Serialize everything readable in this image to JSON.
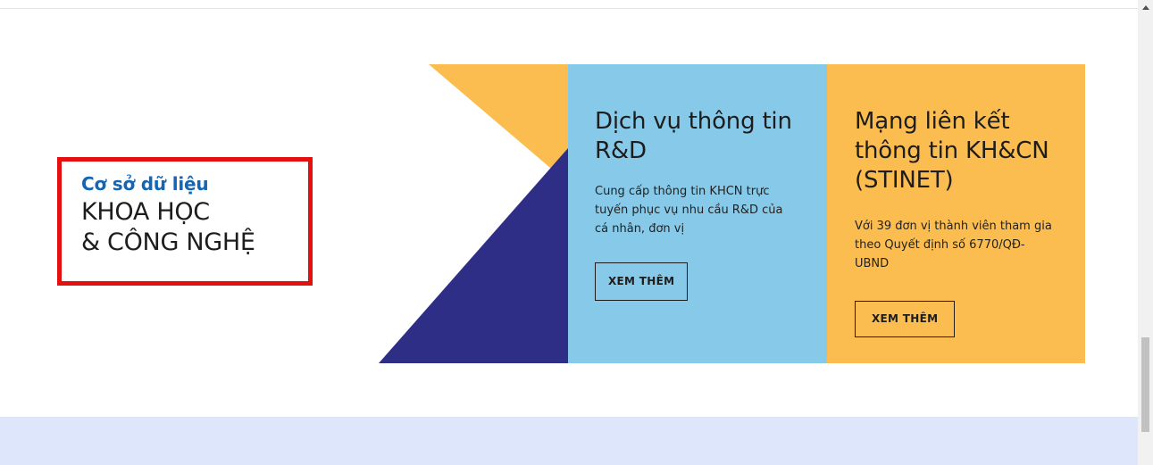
{
  "left_box": {
    "subtitle": "Cơ sở dữ liệu",
    "title_line1": "KHOA HỌC",
    "title_line2": "& CÔNG NGHỆ"
  },
  "cards": [
    {
      "title_line1": "Dịch vụ thông tin",
      "title_line2": "R&D",
      "desc_line1": "Cung cấp thông tin KHCN trực",
      "desc_line2": "tuyến phục vụ nhu cầu R&D của",
      "desc_line3": "cá nhân, đơn vị",
      "button": "XEM THÊM"
    },
    {
      "title_line1": "Mạng liên kết",
      "title_line2": "thông tin KH&CN",
      "title_line3": "(STINET)",
      "desc_line1": "Với 39 đơn vị thành viên tham gia",
      "desc_line2": "theo Quyết định số 6770/QĐ-",
      "desc_line3": "UBND",
      "button": "XEM THÊM"
    }
  ],
  "colors": {
    "box_border": "#e40f0f",
    "subtitle": "#1565b5",
    "blue_card": "#87c9e9",
    "yellow_card": "#fcbd50",
    "navy_triangle": "#2e2e86",
    "bottom_band": "#dde6fb"
  },
  "icons": {
    "scroll_up": "triangle-up-icon"
  }
}
